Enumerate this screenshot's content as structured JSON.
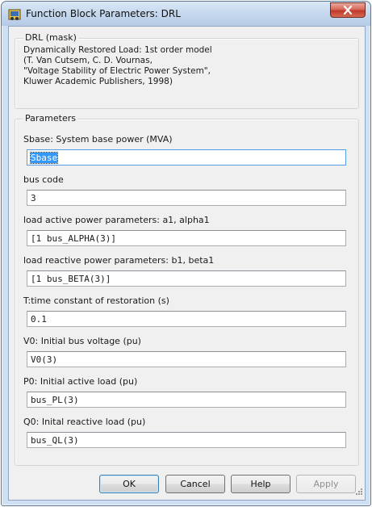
{
  "window": {
    "title": "Function Block Parameters: DRL"
  },
  "mask": {
    "legend": "DRL (mask)",
    "description": [
      "Dynamically Restored Load: 1st order model",
      "(T. Van Cutsem, C. D. Vournas,",
      "\"Voltage Stability of Electric Power System\",",
      "Kluwer Academic Publishers, 1998)"
    ]
  },
  "parameters": {
    "legend": "Parameters",
    "items": [
      {
        "label": "Sbase: System base power (MVA)",
        "value": "Sbase"
      },
      {
        "label": "bus code",
        "value": "3"
      },
      {
        "label": "load active power parameters: a1, alpha1",
        "value": "[1 bus_ALPHA(3)]"
      },
      {
        "label": "load reactive power parameters: b1, beta1",
        "value": "[1 bus_BETA(3)]"
      },
      {
        "label": "T:time constant of restoration (s)",
        "value": "0.1"
      },
      {
        "label": "V0: Initial bus voltage (pu)",
        "value": "V0(3)"
      },
      {
        "label": "P0: Initial active  load (pu)",
        "value": "bus_PL(3)"
      },
      {
        "label": "Q0: Inital reactive load (pu)",
        "value": "bus_QL(3)"
      }
    ]
  },
  "buttons": {
    "ok": "OK",
    "cancel": "Cancel",
    "help": "Help",
    "apply": "Apply"
  },
  "icons": {
    "app": "simulink-icon",
    "close": "close-icon",
    "grip": "resize-grip-icon"
  },
  "colors": {
    "selection": "#3399ff",
    "close_button": "#c0392b",
    "title_bar": "#c3d6ec"
  }
}
